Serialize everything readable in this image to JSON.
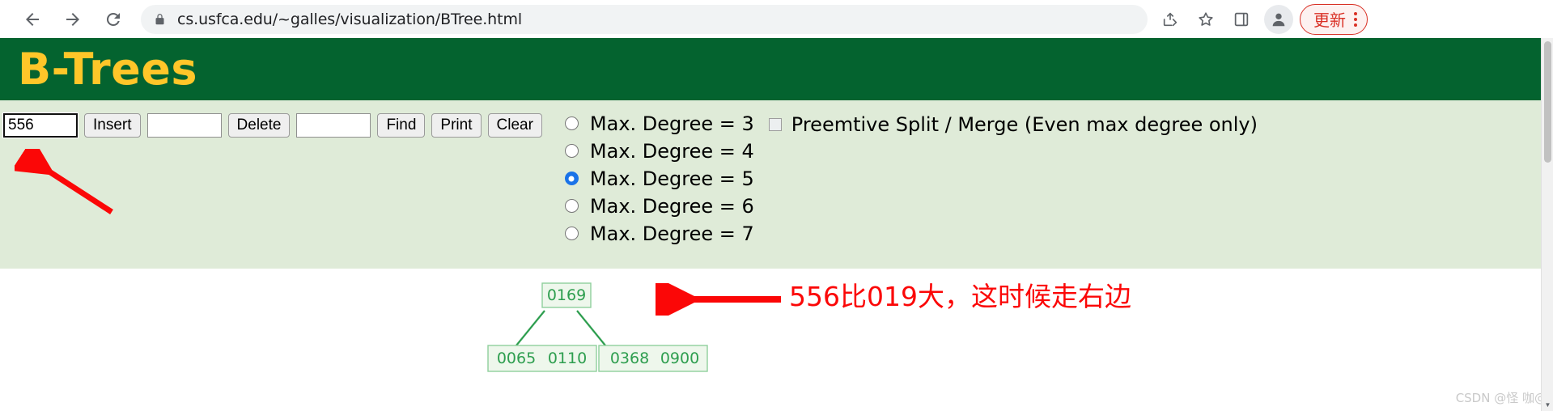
{
  "browser": {
    "back_icon": "back-arrow-icon",
    "forward_icon": "forward-arrow-icon",
    "reload_icon": "reload-icon",
    "lock_icon": "lock-icon",
    "url": "cs.usfca.edu/~galles/visualization/BTree.html",
    "share_icon": "share-icon",
    "bookmark_icon": "star-icon",
    "side_panel_icon": "side-panel-icon",
    "profile_icon": "profile-avatar-icon",
    "update_label": "更新",
    "menu_icon": "three-dot-menu-icon"
  },
  "page": {
    "title": "B-Trees",
    "header_bg": "#04632f",
    "title_color": "#ffc629",
    "controls_bg": "#dfebd8"
  },
  "controls": {
    "insert_value": "556",
    "insert_button": "Insert",
    "delete_value": "",
    "delete_button": "Delete",
    "find_value": "",
    "find_button": "Find",
    "print_button": "Print",
    "clear_button": "Clear",
    "radios": [
      {
        "label": "Max. Degree = 3",
        "checked": false
      },
      {
        "label": "Max. Degree = 4",
        "checked": false
      },
      {
        "label": "Max. Degree = 5",
        "checked": true
      },
      {
        "label": "Max. Degree = 6",
        "checked": false
      },
      {
        "label": "Max. Degree = 7",
        "checked": false
      }
    ],
    "preemptive": {
      "label": "Preemtive Split / Merge (Even max degree only)",
      "checked": false
    },
    "selected_degree": "Max. Degree = 5",
    "accent_color": "#1a73e8"
  },
  "tree": {
    "node_color": "#2e9e4f",
    "node_fill": "#eef7ec",
    "root": {
      "keys": [
        "0169"
      ]
    },
    "children": [
      {
        "keys": [
          "0065",
          "0110"
        ]
      },
      {
        "keys": [
          "0368",
          "0900"
        ]
      }
    ]
  },
  "annotations": {
    "note": "556比019大，这时候走右边",
    "note_color": "#fb0707",
    "arrow_input": "red-arrow-pointing-to-insert-input",
    "arrow_tree": "red-arrow-pointing-to-root-node"
  },
  "watermark": "CSDN @怪 咖@"
}
